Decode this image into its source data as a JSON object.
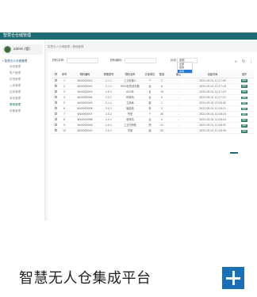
{
  "app": {
    "title": "智慧仓仓储管理"
  },
  "user": {
    "name": "admin (管)"
  },
  "sidebar": {
    "group": "智慧无人仓储管理",
    "items": [
      {
        "label": "系统管理",
        "active": false
      },
      {
        "label": "账户管理",
        "active": false
      },
      {
        "label": "权限管理",
        "active": false
      },
      {
        "label": "入库管理",
        "active": false
      },
      {
        "label": "出库管理",
        "active": false
      },
      {
        "label": "库存管理",
        "active": false
      },
      {
        "label": "基础管理",
        "active": true
      },
      {
        "label": "设备管理",
        "active": false
      }
    ]
  },
  "breadcrumb": "智慧无人仓储管理  /  基础管理",
  "filters": {
    "field1_label": "物料名称:",
    "field2_label": "物料编码:",
    "status_label": "状态:",
    "status_value": "全部",
    "status_options": [
      "全部",
      "启用",
      "停用"
    ]
  },
  "table": {
    "headers": [
      "",
      "序号",
      "物料编码",
      "规格型号",
      "物料名称",
      "计量单位",
      "数量",
      "备注",
      "创建时间",
      "操作"
    ],
    "rows": [
      [
        "1",
        "WL0000001",
        "2.1.1",
        "工业机器人",
        "个",
        "2",
        "-",
        "2022-05-01 11:17:00"
      ],
      [
        "2",
        "WL0000002",
        "2.1.1",
        "RFID标签读写器",
        "台",
        "6",
        "-",
        "2022-05-01 11:17:16"
      ],
      [
        "3",
        "WL0000003",
        "2.0.1",
        "AGV车",
        "台",
        "10",
        "-",
        "2022-05-01 11:17:23"
      ],
      [
        "4",
        "WL0000004",
        "2.2.1",
        "码垛机",
        "台",
        "4",
        "-",
        "2022-05-01 11:17:27"
      ],
      [
        "5",
        "WL0000005",
        "2.1.1",
        "立体库",
        "套",
        "1",
        "-",
        "2022-05-01 11:18:02"
      ],
      [
        "6",
        "WL0000006",
        "2.0.1",
        "输送线",
        "条",
        "3",
        "-",
        "2022-05-01 11:18:11"
      ],
      [
        "7",
        "WL0000007",
        "2.0.2",
        "托盘",
        "个",
        "40",
        "-",
        "2022-05-01 11:18:15"
      ],
      [
        "8",
        "WL0000008",
        "2.0.1",
        "堆垛机",
        "台",
        "4",
        "-",
        "2022-05-01 11:18:24"
      ],
      [
        "9",
        "WL0000009",
        "2.0.1",
        "工业扫码枪",
        "把",
        "12",
        "-",
        "2022-05-01 11:18:31"
      ],
      [
        "10",
        "WL0000010",
        "2.0.1",
        "货架",
        "组",
        "20",
        "-",
        "2022-05-01 11:18:39"
      ]
    ],
    "action_label": "编辑"
  },
  "caption": "智慧无人仓集成平台",
  "icons": {
    "add": "plus-icon",
    "search": "search-icon",
    "refresh": "refresh-icon",
    "more": "more-icon"
  },
  "colors": {
    "topbar": "#1e6b74",
    "accent": "#2a7a5f",
    "plus_button": "#1b6fb5"
  }
}
